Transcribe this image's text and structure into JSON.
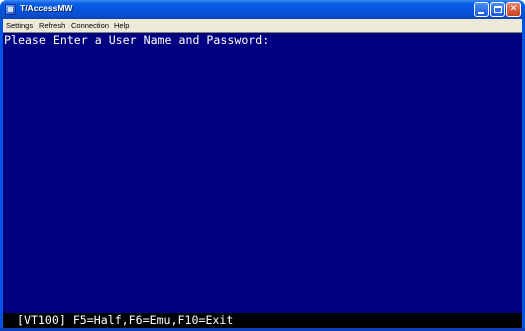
{
  "window": {
    "title": "T/AccessMW",
    "icon": "app-icon",
    "controls": [
      "minimize-icon",
      "maximize-icon",
      "close-icon"
    ],
    "close_symbol": "✕"
  },
  "menubar": {
    "items": [
      {
        "label": "Settings"
      },
      {
        "label": "Refresh"
      },
      {
        "label": "Connection"
      },
      {
        "label": "Help"
      }
    ]
  },
  "terminal": {
    "prompt": "Please Enter a User Name and Password:",
    "background": "#000080",
    "foreground": "#ffffff"
  },
  "statusbar": {
    "text": " [VT100] F5=Half,F6=Emu,F10=Exit"
  }
}
